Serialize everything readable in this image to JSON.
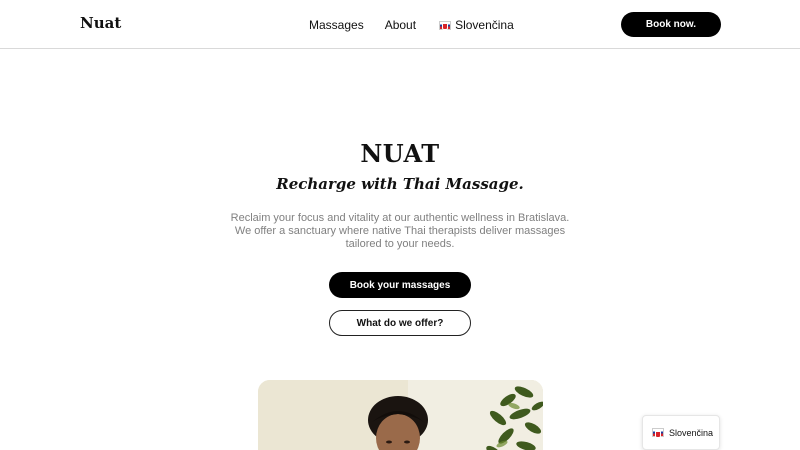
{
  "header": {
    "brand": "Nuat",
    "nav": [
      {
        "label": "Massages"
      },
      {
        "label": "About"
      }
    ],
    "language": {
      "label": "Slovenčina",
      "flag_icon": "slovakia-flag-icon"
    },
    "cta_label": "Book now."
  },
  "hero": {
    "title": "NUAT",
    "subtitle": "Recharge with Thai Massage.",
    "description": "Reclaim your focus and vitality at our authentic wellness in Bratislava. We offer a sanctuary where native Thai therapists deliver massages tailored to your needs.",
    "primary_button": "Book your massages",
    "secondary_button": "What do we offer?"
  },
  "language_widget": {
    "label": "Slovenčina",
    "flag_icon": "slovakia-flag-icon"
  },
  "colors": {
    "primary": "#000000",
    "text": "#111111",
    "muted_text": "#808080",
    "background": "#ffffff",
    "divider": "#d9d9d9"
  }
}
